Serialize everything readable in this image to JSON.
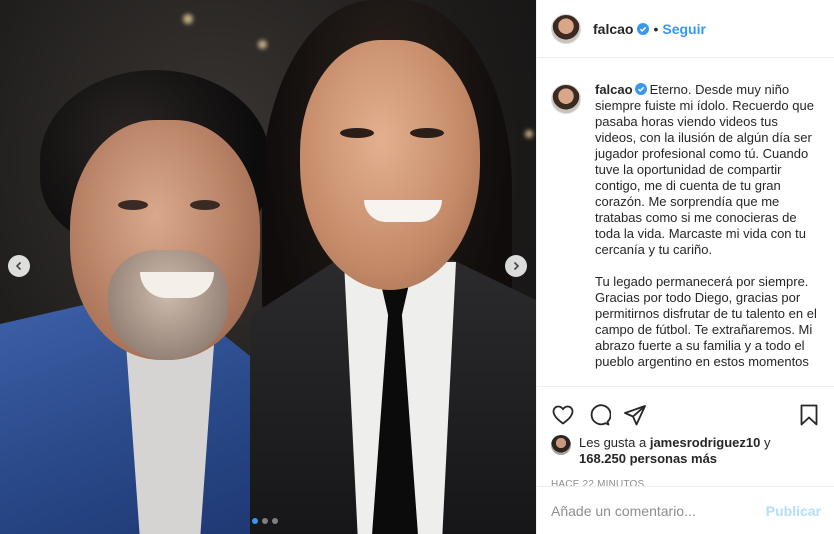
{
  "post": {
    "image_alt": "Foto de Falcao junto a Diego Maradona",
    "carousel": {
      "total": 3,
      "active_index": 1
    }
  },
  "header": {
    "username": "falcao",
    "separator": "•",
    "follow_label": "Seguir"
  },
  "caption": {
    "username": "falcao",
    "paragraphs": [
      "Eterno. Desde muy niño siempre fuiste mi ídolo. Recuerdo que pasaba horas viendo videos tus videos, con la ilusión de algún día ser jugador profesional como tú. Cuando tuve la oportunidad de compartir contigo, me di cuenta de tu gran corazón. Me sorprendía que me tratabas como si me conocieras de toda la vida. Marcaste mi vida con tu cercanía y tu cariño.",
      "Tu legado permanecerá por siempre. Gracias por todo Diego, gracias por permitirnos disfrutar de tu talento en el campo de fútbol. Te extrañaremos. Mi abrazo fuerte a su familia y a todo el pueblo argentino en estos momentos"
    ]
  },
  "actions": {
    "like_icon": "heart-icon",
    "comment_icon": "comment-icon",
    "share_icon": "share-icon",
    "save_icon": "bookmark-icon"
  },
  "likes": {
    "prefix": "Les gusta a ",
    "user": "jamesrodriguez10",
    "mid": " y",
    "count": "168.250 personas más"
  },
  "timestamp": "HACE 22 MINUTOS",
  "comment_box": {
    "placeholder": "Añade un comentario...",
    "publish_label": "Publicar"
  },
  "colors": {
    "accent": "#3897f0",
    "publish_disabled": "#b2dffc",
    "text": "#262626",
    "muted": "#8e8e8e"
  }
}
